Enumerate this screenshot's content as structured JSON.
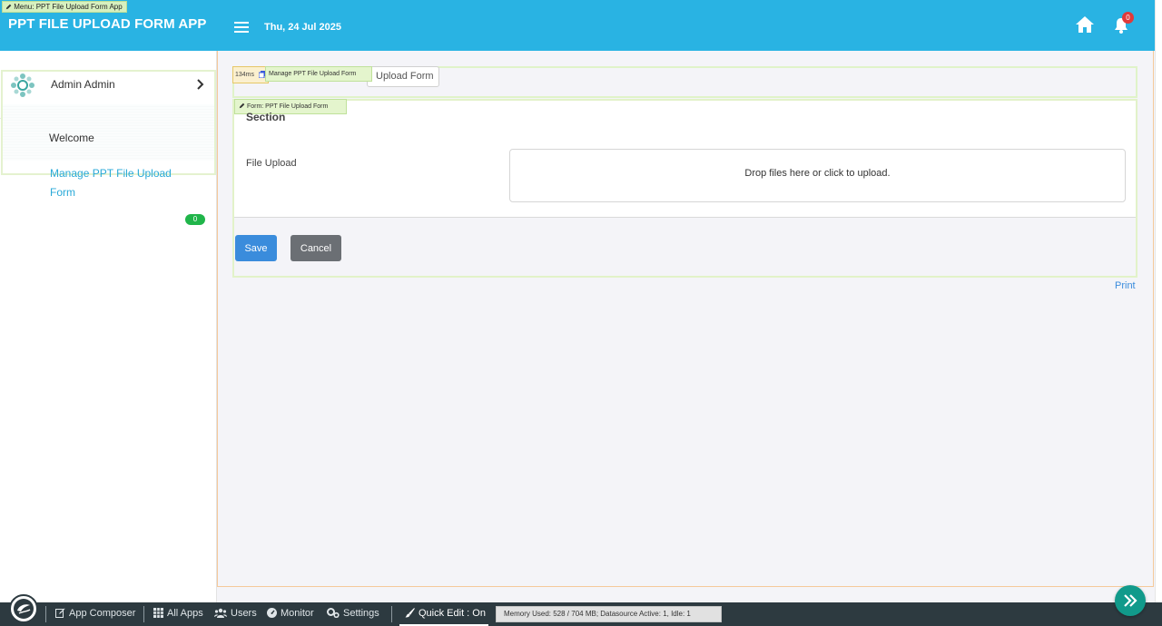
{
  "header": {
    "menu_tag": "Menu: PPT File Upload Form App",
    "app_title": "PPT FILE UPLOAD FORM APP",
    "date": "Thu, 24 Jul 2025",
    "notification_count": "0",
    "bg_color": "#29b3e3"
  },
  "sidebar": {
    "user_name": "Admin Admin",
    "items": [
      {
        "label": "Welcome"
      },
      {
        "label": "Manage PPT File Upload Form",
        "active": true,
        "badge": "0"
      }
    ]
  },
  "breadcrumb": {
    "timing": "134ms",
    "tag": "Manage PPT File Upload Form",
    "current": "Upload Form"
  },
  "form": {
    "tag": "Form: PPT File Upload Form",
    "section_title": "Section",
    "field_label": "File Upload",
    "dropzone_text": "Drop files here or click to upload.",
    "save_label": "Save",
    "cancel_label": "Cancel",
    "print_label": "Print"
  },
  "bottombar": {
    "items": [
      {
        "label": "App Composer",
        "icon": "edit-icon"
      },
      {
        "label": "All Apps",
        "icon": "grid-icon"
      },
      {
        "label": "Users",
        "icon": "users-icon"
      },
      {
        "label": "Monitor",
        "icon": "gauge-icon"
      },
      {
        "label": "Settings",
        "icon": "gears-icon"
      },
      {
        "label": "Quick Edit : On",
        "icon": "brush-icon"
      }
    ],
    "memory": "Memory Used: 528 / 704 MB; Datasource Active: 1, Idle: 1"
  }
}
